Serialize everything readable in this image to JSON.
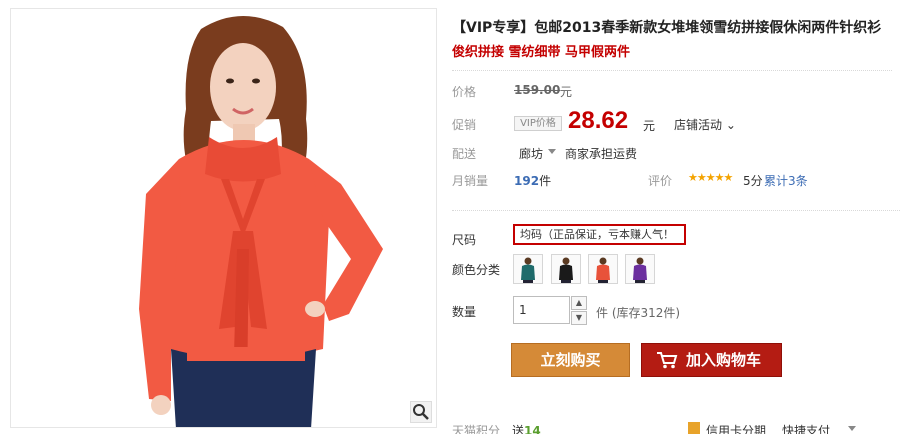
{
  "product": {
    "title": "【VIP专享】包邮2013春季新款女堆堆领雪纺拼接假休闲两件针织衫",
    "subtitle": "俊织拼接 雪纺细带 马甲假两件"
  },
  "pricing": {
    "price_label": "价格",
    "original_price": "159.00",
    "yuan": "元",
    "promo_label": "促销",
    "vip_tag": "VIP价格",
    "promo_price": "28.62",
    "store_promo": "店铺活动"
  },
  "shipping": {
    "label": "配送",
    "from": "廊坊",
    "text": "商家承担运费"
  },
  "sales": {
    "monthly_label": "月销量",
    "monthly_count": "192",
    "unit": "件",
    "review_label": "评价",
    "stars": "★★★★★",
    "score": "5分",
    "total": "累计3条"
  },
  "options": {
    "size_label": "尺码",
    "size_value": "均码（正品保证，亏本赚人气！",
    "color_label": "颜色分类",
    "colors": [
      "#1f6b6b",
      "#1a1a1a",
      "#e8523a",
      "#6b2f9e"
    ]
  },
  "quantity": {
    "label": "数量",
    "value": "1",
    "stock": "件 (库存312件)"
  },
  "actions": {
    "buy": "立刻购买",
    "cart": "加入购物车"
  },
  "footer": {
    "points_label": "天猫积分",
    "points_text": "送",
    "points_value": "14",
    "credit": "信用卡分期",
    "pay": "快捷支付"
  },
  "colors": {
    "brand_red": "#c40000",
    "buy_orange": "#d58a37",
    "cart_red": "#b41c13"
  }
}
